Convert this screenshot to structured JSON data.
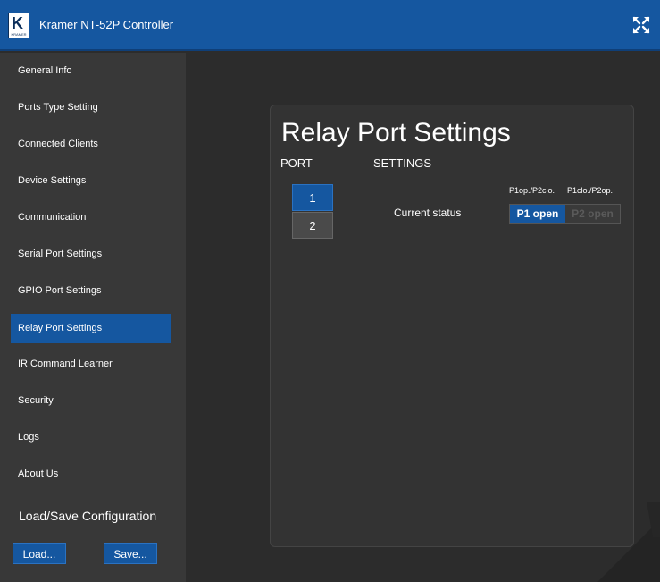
{
  "header": {
    "app_title": "Kramer NT-52P Controller",
    "logo_letter": "K",
    "logo_text": "KRAMER",
    "expand_icon": "expand-arrows-icon"
  },
  "sidebar": {
    "items": [
      {
        "label": "General Info"
      },
      {
        "label": "Ports Type Setting"
      },
      {
        "label": "Connected Clients"
      },
      {
        "label": "Device Settings"
      },
      {
        "label": "Communication"
      },
      {
        "label": "Serial Port Settings"
      },
      {
        "label": "GPIO Port Settings"
      },
      {
        "label": "Relay Port Settings",
        "active": true
      },
      {
        "label": "IR Command Learner"
      },
      {
        "label": "Security"
      },
      {
        "label": "Logs"
      },
      {
        "label": "About Us"
      }
    ],
    "config_title": "Load/Save Configuration",
    "load_label": "Load...",
    "save_label": "Save..."
  },
  "main": {
    "title": "Relay Port Settings",
    "col_port": "PORT",
    "col_settings": "SETTINGS",
    "ports": [
      "1",
      "2"
    ],
    "selected_port": "1",
    "status_label": "Current status",
    "hint_left": "P1op./P2clo.",
    "hint_right": "P1clo./P2op.",
    "toggle_on": "P1 open",
    "toggle_off": "P2 open"
  },
  "colors": {
    "accent": "#1557a0",
    "background": "#2c2c2c",
    "sidebar": "#383838"
  }
}
